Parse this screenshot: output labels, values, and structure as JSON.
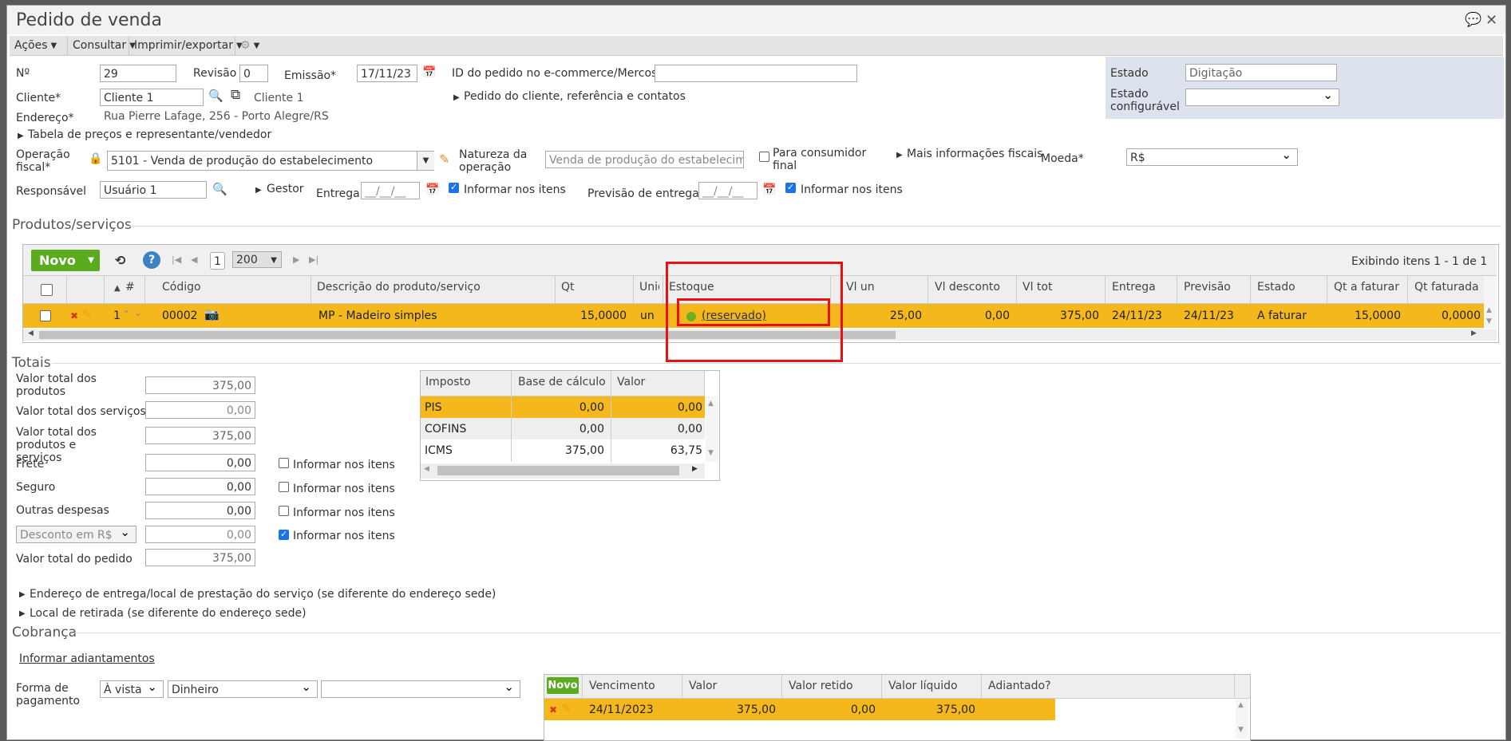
{
  "window": {
    "title": "Pedido de venda"
  },
  "menu": [
    "Ações",
    "Consultar",
    "Imprimir/exportar"
  ],
  "header": {
    "numero_label": "Nº",
    "numero": "29",
    "revisao_label": "Revisão",
    "revisao": "0",
    "emissao_label": "Emissão*",
    "emissao": "17/11/23",
    "ecommerce_label": "ID do pedido no e-commerce/Mercos",
    "ecommerce": "",
    "cliente_label": "Cliente*",
    "cliente": "Cliente 1",
    "cliente_link": "Cliente 1",
    "pedido_cliente": "Pedido do cliente, referência e contatos",
    "endereco_label": "Endereço*",
    "endereco": "Rua Pierre Lafage, 256 - Porto Alegre/RS",
    "tabela_precos": "Tabela de preços e representante/vendedor",
    "operacao_label": "Operação fiscal*",
    "operacao": "5101 - Venda de produção do estabelecimento",
    "natureza_label": "Natureza da operação",
    "natureza": "Venda de produção do estabelecimento",
    "consumidor_label": "Para consumidor final",
    "mais_info": "Mais informações fiscais",
    "moeda_label": "Moeda*",
    "moeda": "R$",
    "responsavel_label": "Responsável",
    "responsavel": "Usuário 1",
    "gestor": "Gestor",
    "entrega_label": "Entrega",
    "entrega": "__/__/__",
    "informar_itens": "Informar nos itens",
    "previsao_label": "Previsão de entrega",
    "previsao": "__/__/__",
    "estado_label": "Estado",
    "estado": "Digitação",
    "estado_conf_label": "Estado configurável",
    "estado_conf": ""
  },
  "produtos": {
    "section": "Produtos/serviços",
    "novo": "Novo",
    "page": "1",
    "page_size": "200",
    "exibindo": "Exibindo itens 1 - 1 de 1",
    "columns": [
      "#",
      "Código",
      "Descrição do produto/serviço",
      "Qt",
      "Unid",
      "Estoque",
      "Vl un",
      "Vl desconto",
      "Vl tot",
      "Entrega",
      "Previsão",
      "Estado",
      "Qt a faturar",
      "Qt faturada"
    ],
    "row": {
      "num": "1",
      "codigo": "00002",
      "descricao": "MP - Madeiro simples",
      "qt": "15,0000",
      "unid": "un",
      "estoque": "(reservado)",
      "vl_un": "25,00",
      "vl_desc": "0,00",
      "vl_tot": "375,00",
      "entrega": "24/11/23",
      "previsao": "24/11/23",
      "estado": "A faturar",
      "qt_faturar": "15,0000",
      "qt_faturada": "0,0000"
    }
  },
  "totais": {
    "section": "Totais",
    "produtos_label": "Valor total dos produtos",
    "produtos": "375,00",
    "servicos_label": "Valor total dos serviços",
    "servicos": "0,00",
    "prod_serv_label": "Valor total dos produtos e serviços",
    "prod_serv": "375,00",
    "frete_label": "Frete",
    "frete": "0,00",
    "seguro_label": "Seguro",
    "seguro": "0,00",
    "outras_label": "Outras despesas",
    "outras": "0,00",
    "desconto_select": "Desconto em R$",
    "desconto": "0,00",
    "pedido_label": "Valor total do pedido",
    "pedido": "375,00",
    "informar": "Informar nos itens"
  },
  "impostos": {
    "columns": [
      "Imposto",
      "Base de cálculo",
      "Valor"
    ],
    "rows": [
      {
        "imposto": "PIS",
        "base": "0,00",
        "valor": "0,00"
      },
      {
        "imposto": "COFINS",
        "base": "0,00",
        "valor": "0,00"
      },
      {
        "imposto": "ICMS",
        "base": "375,00",
        "valor": "63,75"
      }
    ]
  },
  "links": {
    "endereco_entrega": "Endereço de entrega/local de prestação do serviço (se diferente do endereço sede)",
    "local_retirada": "Local de retirada (se diferente do endereço sede)"
  },
  "cobranca": {
    "section": "Cobrança",
    "adiantamentos": "Informar adiantamentos",
    "forma_label": "Forma de pagamento",
    "condicao": "À vista",
    "meio": "Dinheiro",
    "extra": "",
    "novo": "Novo",
    "columns": [
      "Vencimento",
      "Valor",
      "Valor retido",
      "Valor líquido",
      "Adiantado?"
    ],
    "row": {
      "vencimento": "24/11/2023",
      "valor": "375,00",
      "retido": "0,00",
      "liquido": "375,00",
      "adiantado": ""
    }
  },
  "colors": {
    "highlight": "#f5b81c",
    "novo": "#5aab1e",
    "redbox": "#e81010",
    "stock_ok": "#6ab023"
  }
}
